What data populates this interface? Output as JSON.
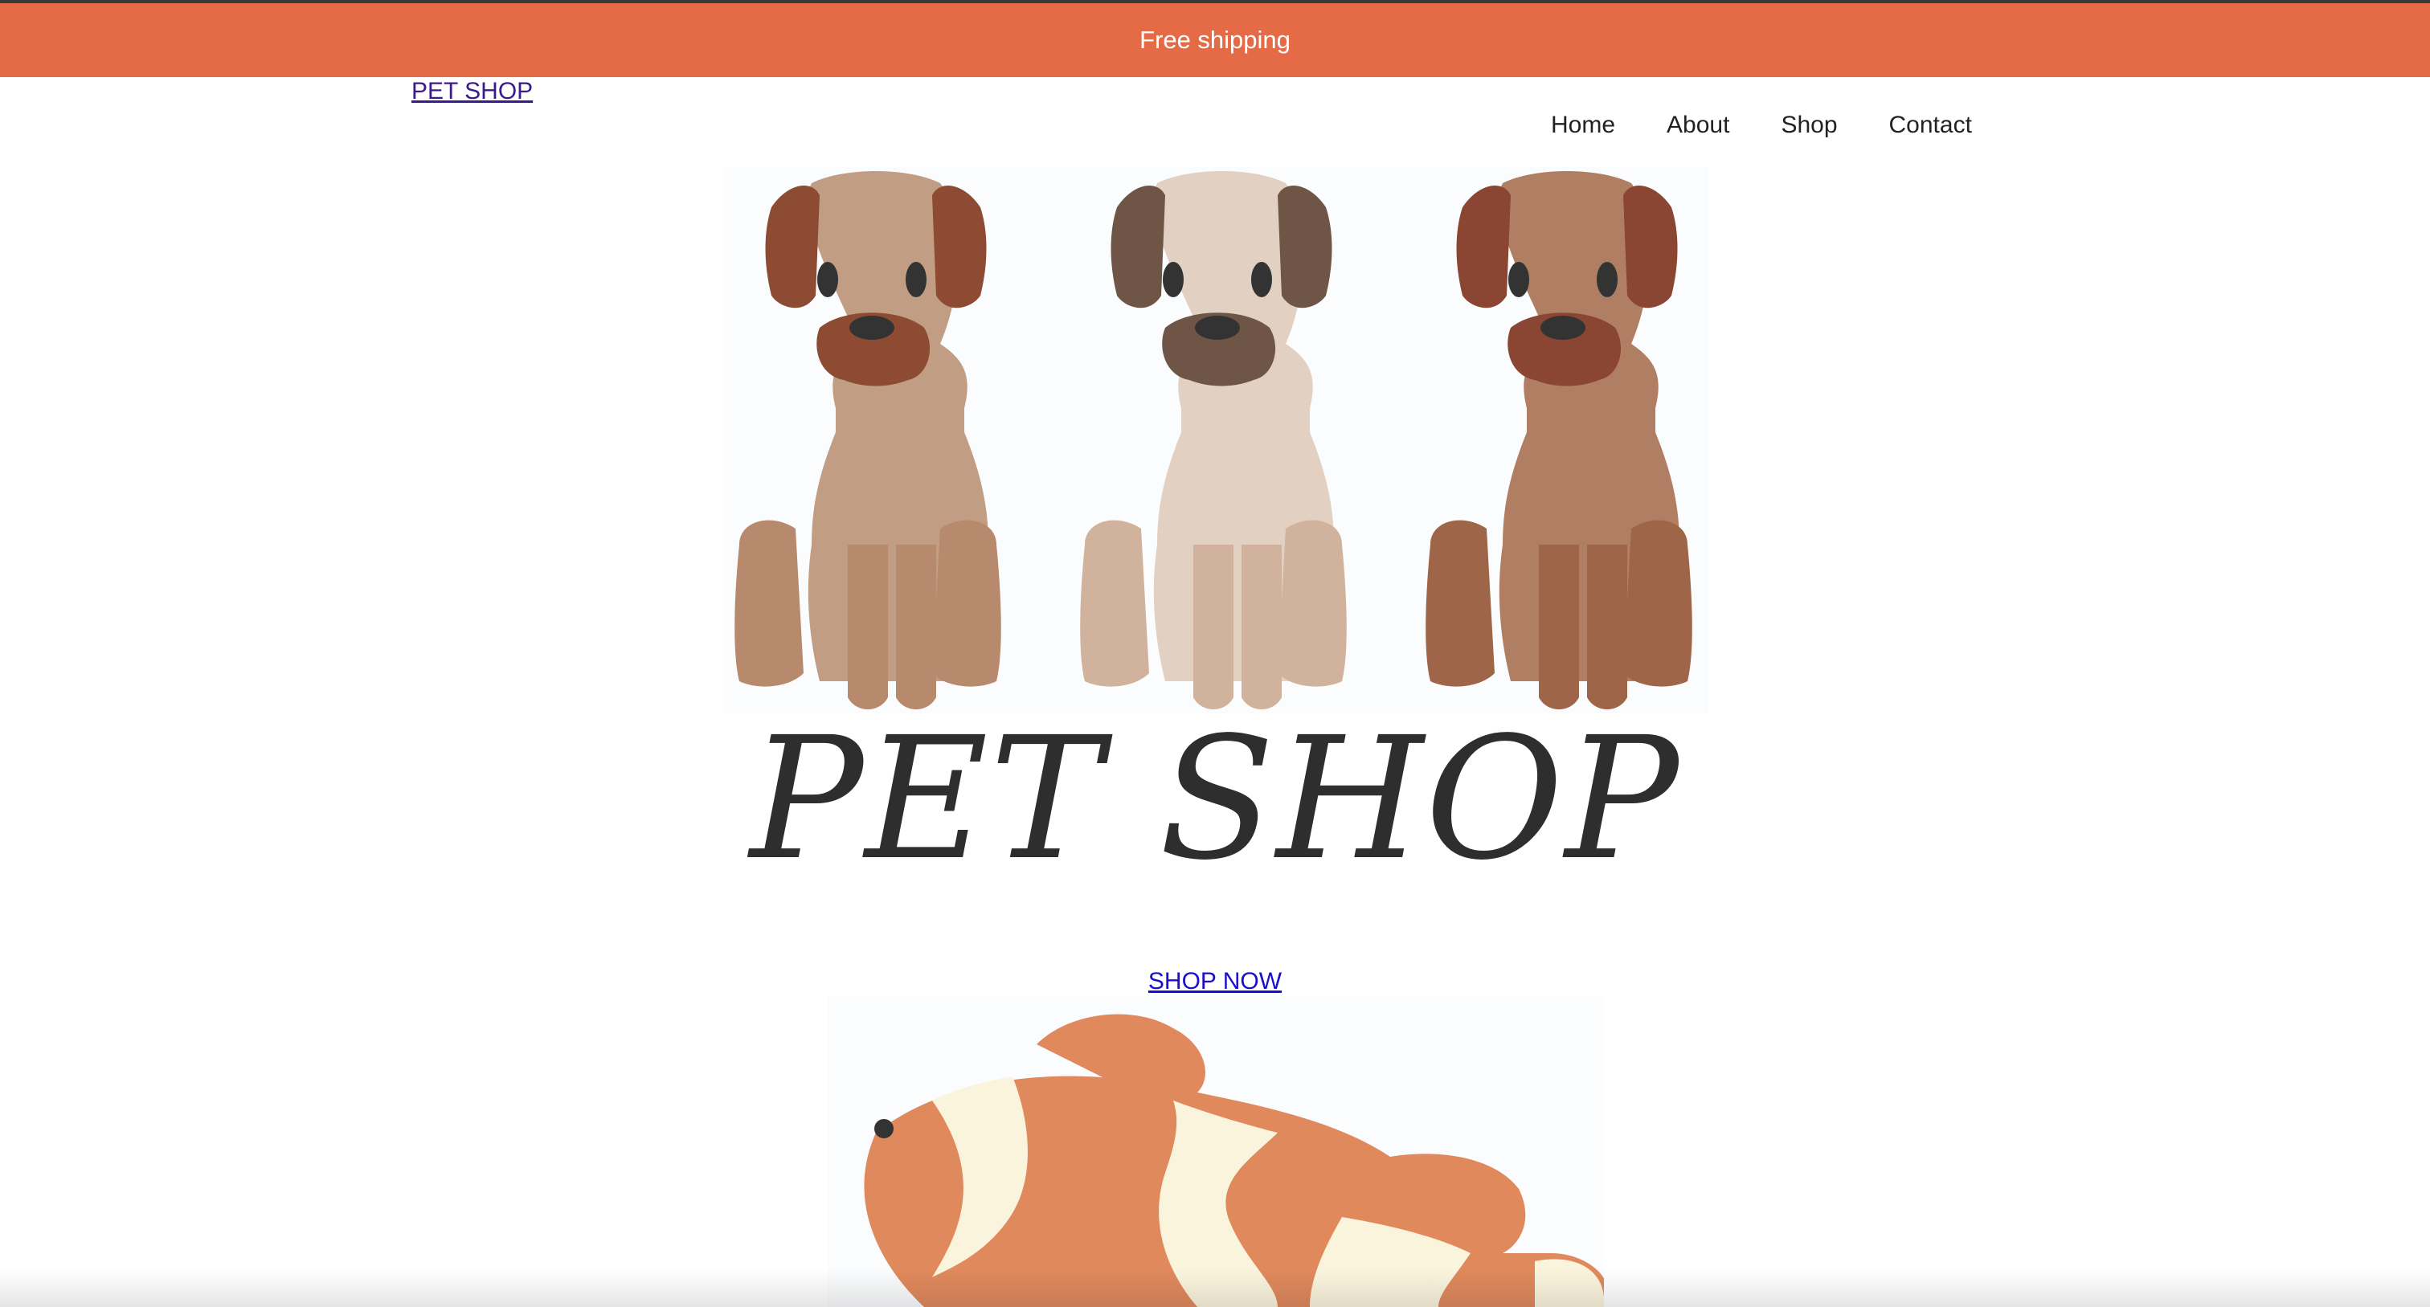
{
  "banner": {
    "text": "Free shipping",
    "color": "#e56b47"
  },
  "header": {
    "brand": "PET SHOP",
    "nav": [
      "Home",
      "About",
      "Shop",
      "Contact"
    ]
  },
  "hero": {
    "title": "PET SHOP",
    "cta": "SHOP NOW",
    "images": [
      "three-dogs-illustration",
      "clownfish-illustration"
    ]
  },
  "colors": {
    "accent": "#e56b47",
    "link": "#1a10cc",
    "visited_link": "#3b1b8a",
    "title_text": "#2e2e2e"
  }
}
